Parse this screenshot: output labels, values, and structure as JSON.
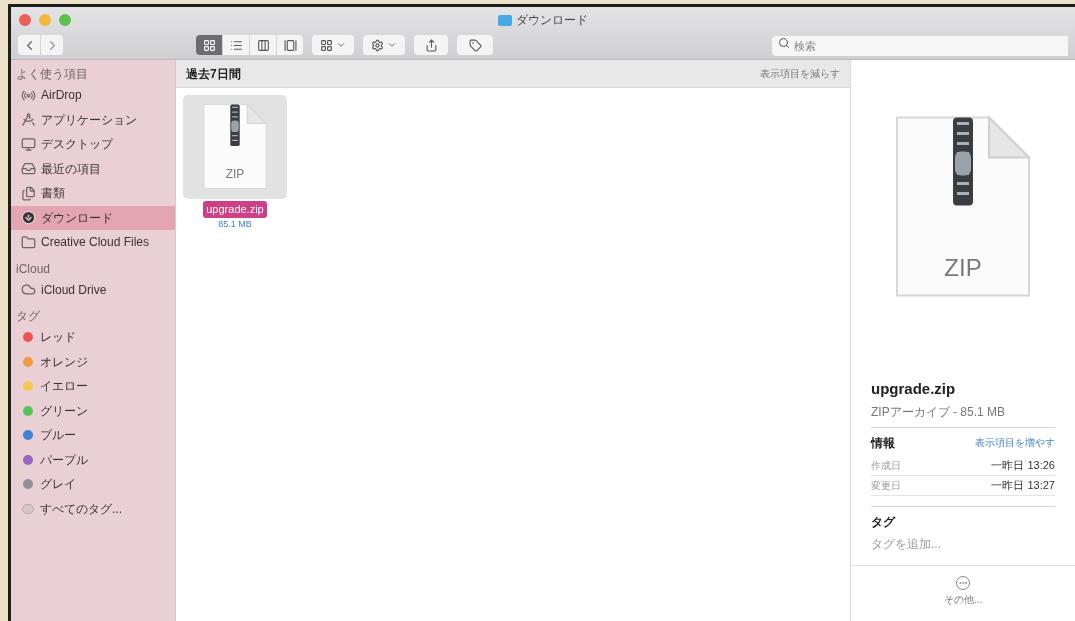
{
  "window": {
    "title": "ダウンロード"
  },
  "toolbar": {
    "view_modes": [
      {
        "kind": "icons",
        "selected": true
      },
      {
        "kind": "list",
        "selected": false
      },
      {
        "kind": "columns",
        "selected": false
      },
      {
        "kind": "gallery",
        "selected": false
      }
    ]
  },
  "search": {
    "placeholder": "検索"
  },
  "sidebar": {
    "sections": [
      {
        "title": "よく使う項目",
        "items": [
          {
            "label": "AirDrop",
            "kind": "airdrop",
            "selected": false
          },
          {
            "label": "アプリケーション",
            "kind": "apps",
            "selected": false
          },
          {
            "label": "デスクトップ",
            "kind": "desktop",
            "selected": false
          },
          {
            "label": "最近の項目",
            "kind": "recents",
            "selected": false
          },
          {
            "label": "書類",
            "kind": "documents",
            "selected": false
          },
          {
            "label": "ダウンロード",
            "kind": "downloads",
            "selected": true
          },
          {
            "label": "Creative Cloud Files",
            "kind": "folder",
            "selected": false
          }
        ]
      },
      {
        "title": "iCloud",
        "items": [
          {
            "label": "iCloud Drive",
            "kind": "cloud",
            "selected": false
          }
        ]
      },
      {
        "title": "タグ",
        "items": [
          {
            "label": "レッド",
            "kind": "tag",
            "color": "#ec5550",
            "selected": false
          },
          {
            "label": "オレンジ",
            "kind": "tag",
            "color": "#f19a45",
            "selected": false
          },
          {
            "label": "イエロー",
            "kind": "tag",
            "color": "#f2c94c",
            "selected": false
          },
          {
            "label": "グリーン",
            "kind": "tag",
            "color": "#55c35b",
            "selected": false
          },
          {
            "label": "ブルー",
            "kind": "tag",
            "color": "#3d82d6",
            "selected": false
          },
          {
            "label": "パープル",
            "kind": "tag",
            "color": "#9a64c2",
            "selected": false
          },
          {
            "label": "グレイ",
            "kind": "tag",
            "color": "#8e9197",
            "selected": false
          },
          {
            "label": "すべてのタグ...",
            "kind": "all-tags",
            "selected": false
          }
        ]
      }
    ]
  },
  "content": {
    "group_title": "過去7日間",
    "group_action": "表示項目を減らす",
    "files": [
      {
        "name": "upgrade.zip",
        "size": "85.1 MB",
        "type_label": "ZIP",
        "selected": true
      }
    ]
  },
  "preview": {
    "type_label": "ZIP",
    "name": "upgrade.zip",
    "subtitle": "ZIPアーカイブ - 85.1 MB",
    "info_title": "情報",
    "info_action": "表示項目を増やす",
    "rows": [
      {
        "label": "作成日",
        "value": "一昨日 13:26"
      },
      {
        "label": "変更日",
        "value": "一昨日 13:27"
      }
    ],
    "tags_title": "タグ",
    "tags_placeholder": "タグを追加...",
    "more_label": "その他..."
  }
}
